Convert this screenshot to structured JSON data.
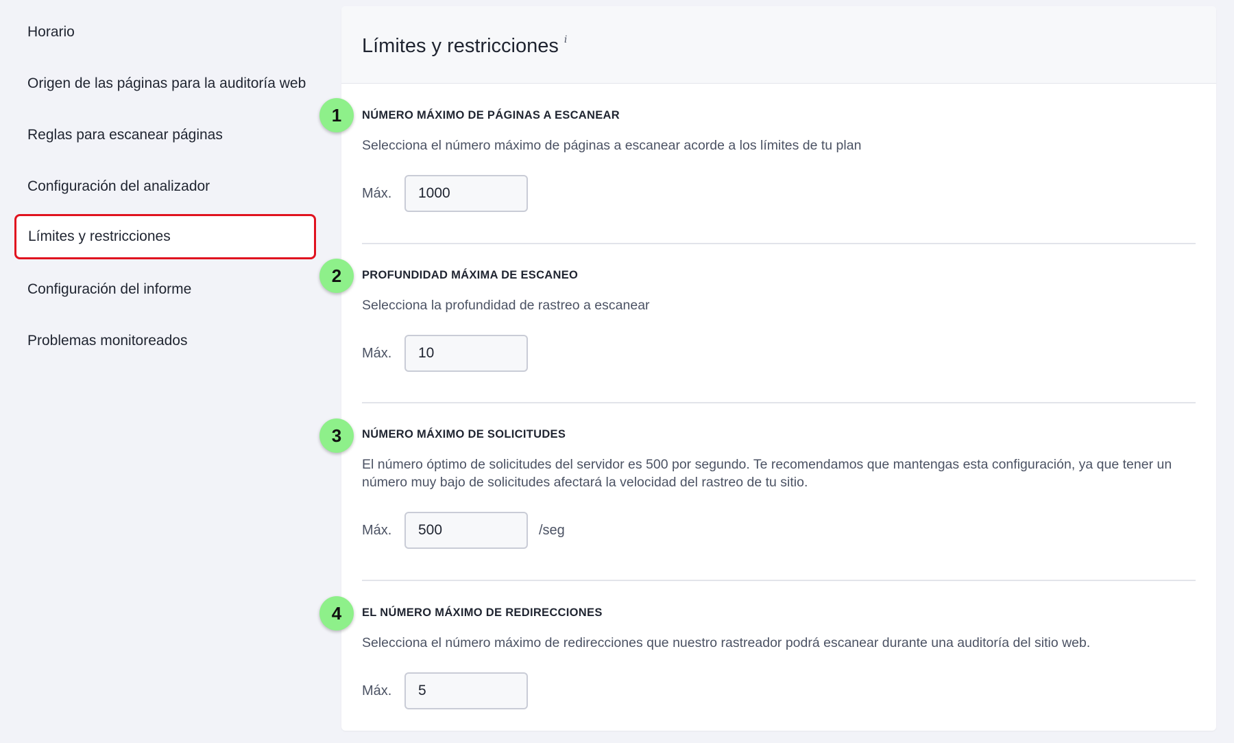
{
  "sidebar": {
    "items": [
      {
        "label": "Horario"
      },
      {
        "label": "Origen de las páginas para la auditoría web"
      },
      {
        "label": "Reglas para escanear páginas"
      },
      {
        "label": "Configuración del analizador"
      },
      {
        "label": "Límites y restricciones"
      },
      {
        "label": "Configuración del informe"
      },
      {
        "label": "Problemas monitoreados"
      }
    ],
    "active_index": 4,
    "highlight_color": "#e0121f"
  },
  "panel": {
    "title": "Límites y restricciones",
    "info_glyph": "i"
  },
  "sections": [
    {
      "badge": "1",
      "title": "NÚMERO MÁXIMO DE PÁGINAS A ESCANEAR",
      "description": "Selecciona el número máximo de páginas a escanear acorde a los límites de tu plan",
      "field_label": "Máx.",
      "value": "1000",
      "unit": ""
    },
    {
      "badge": "2",
      "title": "PROFUNDIDAD MÁXIMA DE ESCANEO",
      "description": "Selecciona la profundidad de rastreo a escanear",
      "field_label": "Máx.",
      "value": "10",
      "unit": ""
    },
    {
      "badge": "3",
      "title": "NÚMERO MÁXIMO DE SOLICITUDES",
      "description": "El número óptimo de solicitudes del servidor es 500 por segundo. Te recomendamos que mantengas esta configuración, ya que tener un número muy bajo de solicitudes afectará la velocidad del rastreo de tu sitio.",
      "field_label": "Máx.",
      "value": "500",
      "unit": "/seg"
    },
    {
      "badge": "4",
      "title": "EL NÚMERO MÁXIMO DE REDIRECCIONES",
      "description": "Selecciona el número máximo de redirecciones que nuestro rastreador podrá escanear durante una auditoría del sitio web.",
      "field_label": "Máx.",
      "value": "5",
      "unit": ""
    }
  ],
  "colors": {
    "badge": "#8ef08a",
    "page_background": "#f2f3f8"
  }
}
